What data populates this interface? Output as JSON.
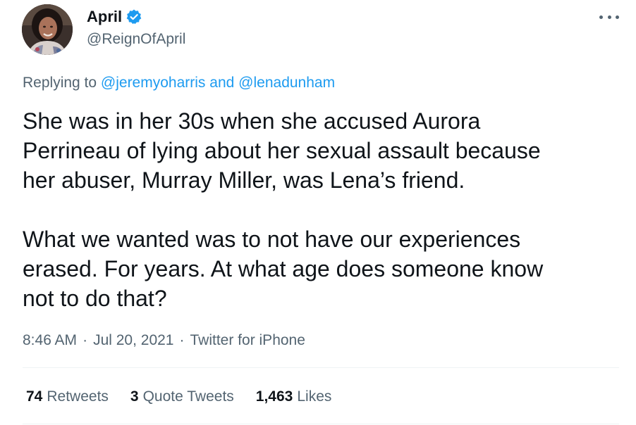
{
  "author": {
    "display_name": "April",
    "handle": "@ReignOfApril",
    "verified": true,
    "avatar_icon": "user-avatar-photo"
  },
  "more_icon": "more-options-icon",
  "reply": {
    "prefix": "Replying to",
    "mention_1": "@jeremyoharris",
    "joiner": "and",
    "mention_2": "@lenadunham"
  },
  "tweet": {
    "paragraph_1": "She was in her 30s when she accused Aurora\nPerrineau of lying about her sexual assault because\nher abuser, Murray Miller, was Lena’s friend.",
    "paragraph_2": "What we wanted was to not have our experiences\nerased. For years. At what age does someone know\nnot to do that?"
  },
  "meta": {
    "time": "8:46 AM",
    "separator": "·",
    "date": "Jul 20, 2021",
    "source": "Twitter for iPhone"
  },
  "stats": {
    "retweets_count": "74",
    "retweets_label": "Retweets",
    "quotes_count": "3",
    "quotes_label": "Quote Tweets",
    "likes_count": "1,463",
    "likes_label": "Likes"
  },
  "colors": {
    "accent": "#1d9bf0",
    "text_primary": "#0f1419",
    "text_secondary": "#536471",
    "divider": "#eff3f4"
  }
}
